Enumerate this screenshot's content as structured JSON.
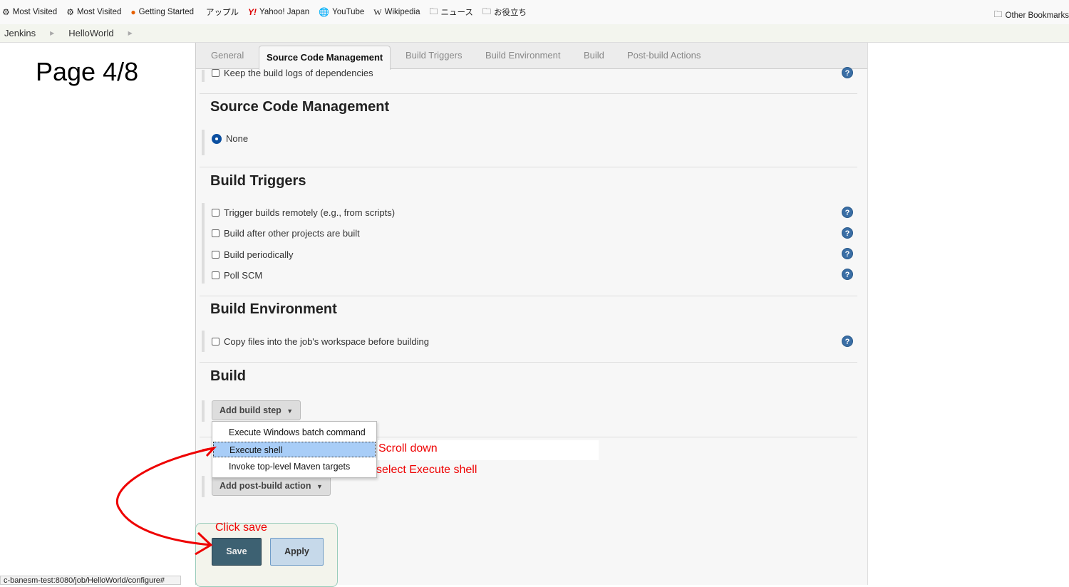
{
  "bookmarks": {
    "items": [
      {
        "label": "Most Visited",
        "icon": "gear-icon"
      },
      {
        "label": "Most Visited",
        "icon": "gear-icon"
      },
      {
        "label": "Getting Started",
        "icon": "firefox-icon"
      },
      {
        "label": "アップル",
        "icon": "apple-icon"
      },
      {
        "label": "Yahoo! Japan",
        "icon": "yahoo-icon"
      },
      {
        "label": "YouTube",
        "icon": "globe-icon"
      },
      {
        "label": "Wikipedia",
        "icon": "wikipedia-icon"
      },
      {
        "label": "ニュース",
        "icon": "folder-icon"
      },
      {
        "label": "お役立ち",
        "icon": "folder-icon"
      }
    ],
    "other": "Other Bookmarks"
  },
  "breadcrumb": [
    "Jenkins",
    "HelloWorld"
  ],
  "page_label": "Page 4/8",
  "tabs": [
    "General",
    "Source Code Management",
    "Build Triggers",
    "Build Environment",
    "Build",
    "Post-build Actions"
  ],
  "general": {
    "keep_logs": "Keep the build logs of dependencies"
  },
  "scm": {
    "title": "Source Code Management",
    "none": "None"
  },
  "triggers": {
    "title": "Build Triggers",
    "items": [
      "Trigger builds remotely (e.g., from scripts)",
      "Build after other projects are built",
      "Build periodically",
      "Poll SCM"
    ]
  },
  "env": {
    "title": "Build Environment",
    "copy": "Copy files into the job's workspace before building"
  },
  "build": {
    "title": "Build",
    "add_step": "Add build step",
    "menu": [
      "Execute Windows batch command",
      "Execute shell",
      "Invoke top-level Maven targets"
    ]
  },
  "post": {
    "add_action": "Add post-build action"
  },
  "annotations": {
    "scroll": "Scroll down",
    "select": "select Execute shell",
    "save": "Click save",
    "color": "#e00000"
  },
  "buttons": {
    "save": "Save",
    "apply": "Apply"
  },
  "status_url": "c-banesm-test:8080/job/HelloWorld/configure#"
}
